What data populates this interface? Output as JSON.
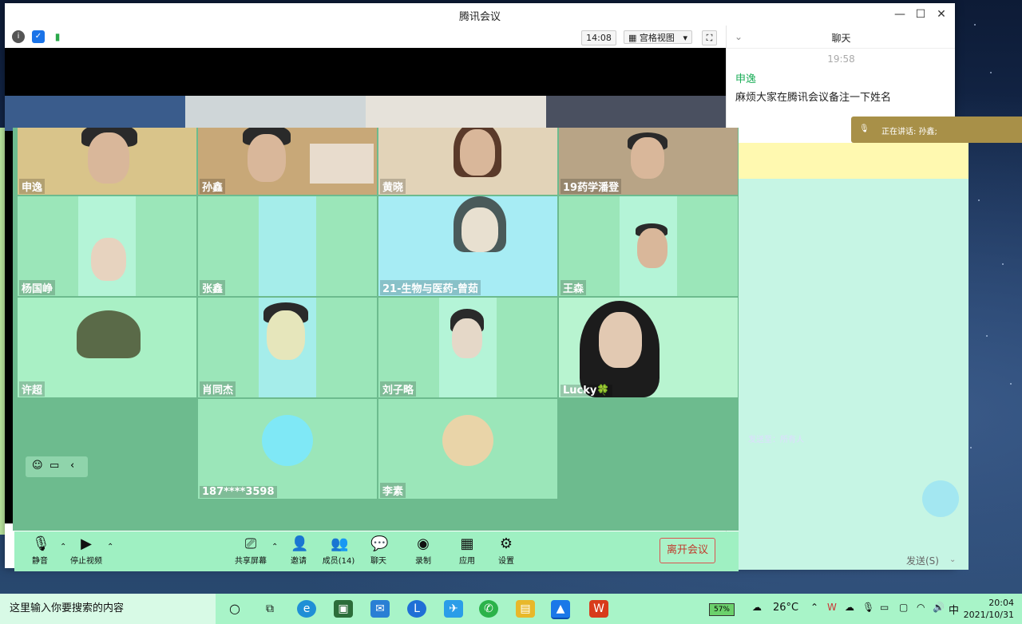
{
  "window": {
    "title": "腾讯会议",
    "minimize_glyph": "—",
    "maximize_glyph": "☐",
    "close_glyph": "✕"
  },
  "toolstrip": {
    "time": "14:08",
    "view_mode": "宫格视图",
    "view_caret": "▾",
    "fullscreen_glyph": "⛶"
  },
  "participants": [
    {
      "name": "申逸"
    },
    {
      "name": "孙鑫"
    },
    {
      "name": "黄晓"
    },
    {
      "name": "19药学潘登"
    },
    {
      "name": "杨国峥"
    },
    {
      "name": "张鑫"
    },
    {
      "name": "21-生物与医药-曾茹"
    },
    {
      "name": "王森"
    },
    {
      "name": "许超"
    },
    {
      "name": "肖同杰"
    },
    {
      "name": "刘子略"
    },
    {
      "name": "Lucky🍀"
    },
    {
      "name": "187****3598"
    },
    {
      "name": "李素"
    }
  ],
  "controls": {
    "mute": "静音",
    "stop_video": "停止视频",
    "share_screen": "共享屏幕",
    "invite": "邀请",
    "members": "成员(14)",
    "chat": "聊天",
    "record": "录制",
    "apps": "应用",
    "settings": "设置",
    "leave": "离开会议"
  },
  "chat": {
    "header": "聊天",
    "time": "19:58",
    "sender": "申逸",
    "message": "麻烦大家在腾讯会议备注一下姓名",
    "speaking_label": "正在讲话: 孙鑫;",
    "send_to": "发送至：所有人",
    "send_button": "发送(S)"
  },
  "taskbar": {
    "search_placeholder": "这里输入你要搜索的内容",
    "battery": "57%",
    "temperature": "26°C",
    "ime": "中",
    "clock_time": "20:04",
    "clock_date": "2021/10/31"
  }
}
